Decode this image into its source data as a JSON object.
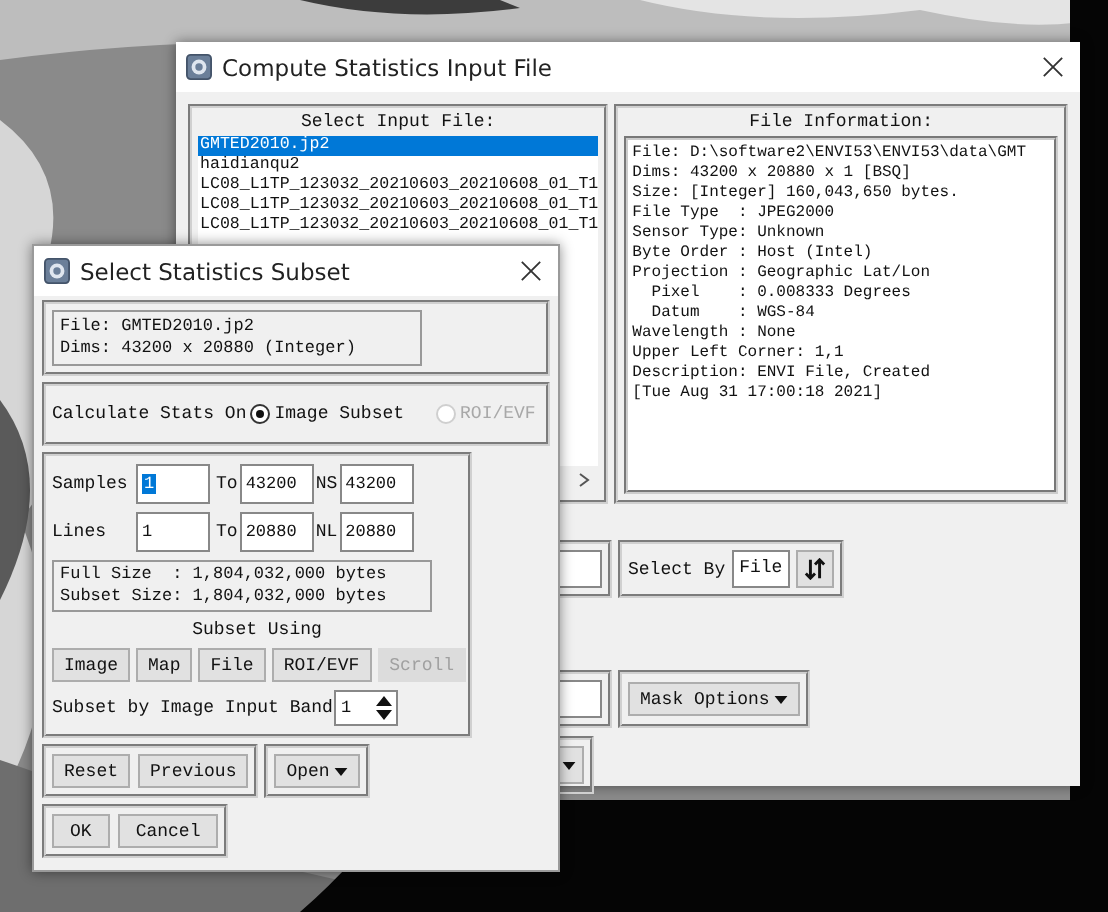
{
  "main_window": {
    "title": "Compute Statistics Input File",
    "input_list": {
      "heading": "Select Input File:",
      "items": [
        {
          "label": "GMTED2010.jp2",
          "selected": true
        },
        {
          "label": "haidianqu2",
          "selected": false
        },
        {
          "label": "LC08_L1TP_123032_20210603_20210608_01_T1",
          "selected": false
        },
        {
          "label": "LC08_L1TP_123032_20210603_20210608_01_T1",
          "selected": false
        },
        {
          "label": "LC08_L1TP_123032_20210603_20210608_01_T1",
          "selected": false
        }
      ]
    },
    "file_info": {
      "heading": "File Information:",
      "lines": [
        "File: D:\\software2\\ENVI53\\ENVI53\\data\\GMT",
        "Dims: 43200 x 20880 x 1 [BSQ]",
        "Size: [Integer] 160,043,650 bytes.",
        "File Type  : JPEG2000",
        "Sensor Type: Unknown",
        "Byte Order : Host (Intel)",
        "Projection : Geographic Lat/Lon",
        "  Pixel    : 0.008333 Degrees",
        "  Datum    : WGS-84",
        "Wavelength : None",
        "Upper Left Corner: 1,1",
        "Description: ENVI File, Created",
        "[Tue Aug 31 17:00:18 2021]"
      ]
    },
    "select_by": {
      "label": "Select By",
      "value": "File"
    },
    "mask_button": "Mask Options"
  },
  "subset_dialog": {
    "title": "Select Statistics Subset",
    "file_lines": [
      "File: GMTED2010.jp2",
      "Dims: 43200 x 20880 (Integer)"
    ],
    "calc": {
      "label": "Calculate Stats On",
      "options": [
        {
          "label": "Image Subset",
          "selected": true,
          "disabled": false
        },
        {
          "label": "ROI/EVF",
          "selected": false,
          "disabled": true
        }
      ]
    },
    "ranges": [
      {
        "label": "Samples",
        "from": "1",
        "to_label": "To",
        "to": "43200",
        "n_label": "NS",
        "n": "43200"
      },
      {
        "label": "Lines",
        "from": "1",
        "to_label": "To",
        "to": "20880",
        "n_label": "NL",
        "n": "20880"
      }
    ],
    "size_lines": [
      "Full Size  : 1,804,032,000 bytes",
      "Subset Size: 1,804,032,000 bytes"
    ],
    "subset_using": {
      "heading": "Subset Using",
      "buttons": [
        {
          "label": "Image",
          "disabled": false
        },
        {
          "label": "Map",
          "disabled": false
        },
        {
          "label": "File",
          "disabled": false
        },
        {
          "label": "ROI/EVF",
          "disabled": false
        },
        {
          "label": "Scroll",
          "disabled": true
        }
      ]
    },
    "band": {
      "label": "Subset by Image Input Band",
      "value": "1"
    },
    "row1_buttons": [
      "Reset",
      "Previous"
    ],
    "open_button": "Open",
    "row2_buttons": [
      "OK",
      "Cancel"
    ]
  }
}
